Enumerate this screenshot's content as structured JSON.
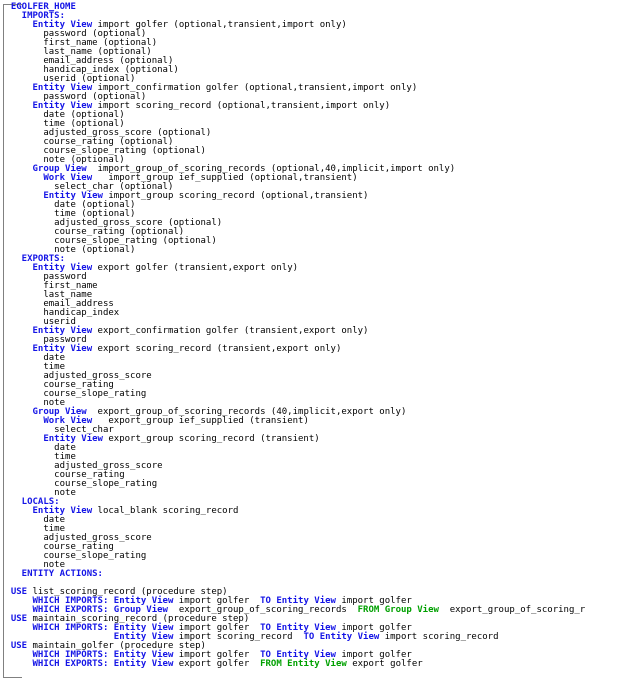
{
  "view": {
    "title": "EGOLFER_HOME",
    "frame_color": "#808080",
    "background": "#ffffff",
    "keyword_color": "#1414e6",
    "from_keyword_color": "#00a000",
    "text_color": "#000000"
  },
  "lines": [
    {
      "indent": 2,
      "parts": [
        {
          "t": "EGOLFER_HOME",
          "c": "kw"
        }
      ]
    },
    {
      "indent": 4,
      "parts": [
        {
          "t": "IMPORTS:",
          "c": "kw"
        }
      ]
    },
    {
      "indent": 6,
      "parts": [
        {
          "t": "Entity View",
          "c": "kw"
        },
        {
          "t": " import golfer (optional,transient,import only)",
          "c": "pln"
        }
      ]
    },
    {
      "indent": 8,
      "parts": [
        {
          "t": "password (optional)",
          "c": "pln"
        }
      ]
    },
    {
      "indent": 8,
      "parts": [
        {
          "t": "first_name (optional)",
          "c": "pln"
        }
      ]
    },
    {
      "indent": 8,
      "parts": [
        {
          "t": "last_name (optional)",
          "c": "pln"
        }
      ]
    },
    {
      "indent": 8,
      "parts": [
        {
          "t": "email_address (optional)",
          "c": "pln"
        }
      ]
    },
    {
      "indent": 8,
      "parts": [
        {
          "t": "handicap_index (optional)",
          "c": "pln"
        }
      ]
    },
    {
      "indent": 8,
      "parts": [
        {
          "t": "userid (optional)",
          "c": "pln"
        }
      ]
    },
    {
      "indent": 6,
      "parts": [
        {
          "t": "Entity View",
          "c": "kw"
        },
        {
          "t": " import_confirmation golfer (optional,transient,import only)",
          "c": "pln"
        }
      ]
    },
    {
      "indent": 8,
      "parts": [
        {
          "t": "password (optional)",
          "c": "pln"
        }
      ]
    },
    {
      "indent": 6,
      "parts": [
        {
          "t": "Entity View",
          "c": "kw"
        },
        {
          "t": " import scoring_record (optional,transient,import only)",
          "c": "pln"
        }
      ]
    },
    {
      "indent": 8,
      "parts": [
        {
          "t": "date (optional)",
          "c": "pln"
        }
      ]
    },
    {
      "indent": 8,
      "parts": [
        {
          "t": "time (optional)",
          "c": "pln"
        }
      ]
    },
    {
      "indent": 8,
      "parts": [
        {
          "t": "adjusted_gross_score (optional)",
          "c": "pln"
        }
      ]
    },
    {
      "indent": 8,
      "parts": [
        {
          "t": "course_rating (optional)",
          "c": "pln"
        }
      ]
    },
    {
      "indent": 8,
      "parts": [
        {
          "t": "course_slope_rating (optional)",
          "c": "pln"
        }
      ]
    },
    {
      "indent": 8,
      "parts": [
        {
          "t": "note (optional)",
          "c": "pln"
        }
      ]
    },
    {
      "indent": 6,
      "parts": [
        {
          "t": "Group View",
          "c": "kw"
        },
        {
          "t": "  import_group_of_scoring_records (optional,40,implicit,import only)",
          "c": "pln"
        }
      ]
    },
    {
      "indent": 8,
      "parts": [
        {
          "t": "Work View",
          "c": "kw"
        },
        {
          "t": "   import_group ief_supplied (optional,transient)",
          "c": "pln"
        }
      ]
    },
    {
      "indent": 10,
      "parts": [
        {
          "t": "select_char (optional)",
          "c": "pln"
        }
      ]
    },
    {
      "indent": 8,
      "parts": [
        {
          "t": "Entity View",
          "c": "kw"
        },
        {
          "t": " import_group scoring_record (optional,transient)",
          "c": "pln"
        }
      ]
    },
    {
      "indent": 10,
      "parts": [
        {
          "t": "date (optional)",
          "c": "pln"
        }
      ]
    },
    {
      "indent": 10,
      "parts": [
        {
          "t": "time (optional)",
          "c": "pln"
        }
      ]
    },
    {
      "indent": 10,
      "parts": [
        {
          "t": "adjusted_gross_score (optional)",
          "c": "pln"
        }
      ]
    },
    {
      "indent": 10,
      "parts": [
        {
          "t": "course_rating (optional)",
          "c": "pln"
        }
      ]
    },
    {
      "indent": 10,
      "parts": [
        {
          "t": "course_slope_rating (optional)",
          "c": "pln"
        }
      ]
    },
    {
      "indent": 10,
      "parts": [
        {
          "t": "note (optional)",
          "c": "pln"
        }
      ]
    },
    {
      "indent": 4,
      "parts": [
        {
          "t": "EXPORTS:",
          "c": "kw"
        }
      ]
    },
    {
      "indent": 6,
      "parts": [
        {
          "t": "Entity View",
          "c": "kw"
        },
        {
          "t": " export golfer (transient,export only)",
          "c": "pln"
        }
      ]
    },
    {
      "indent": 8,
      "parts": [
        {
          "t": "password",
          "c": "pln"
        }
      ]
    },
    {
      "indent": 8,
      "parts": [
        {
          "t": "first_name",
          "c": "pln"
        }
      ]
    },
    {
      "indent": 8,
      "parts": [
        {
          "t": "last_name",
          "c": "pln"
        }
      ]
    },
    {
      "indent": 8,
      "parts": [
        {
          "t": "email_address",
          "c": "pln"
        }
      ]
    },
    {
      "indent": 8,
      "parts": [
        {
          "t": "handicap_index",
          "c": "pln"
        }
      ]
    },
    {
      "indent": 8,
      "parts": [
        {
          "t": "userid",
          "c": "pln"
        }
      ]
    },
    {
      "indent": 6,
      "parts": [
        {
          "t": "Entity View",
          "c": "kw"
        },
        {
          "t": " export_confirmation golfer (transient,export only)",
          "c": "pln"
        }
      ]
    },
    {
      "indent": 8,
      "parts": [
        {
          "t": "password",
          "c": "pln"
        }
      ]
    },
    {
      "indent": 6,
      "parts": [
        {
          "t": "Entity View",
          "c": "kw"
        },
        {
          "t": " export scoring_record (transient,export only)",
          "c": "pln"
        }
      ]
    },
    {
      "indent": 8,
      "parts": [
        {
          "t": "date",
          "c": "pln"
        }
      ]
    },
    {
      "indent": 8,
      "parts": [
        {
          "t": "time",
          "c": "pln"
        }
      ]
    },
    {
      "indent": 8,
      "parts": [
        {
          "t": "adjusted_gross_score",
          "c": "pln"
        }
      ]
    },
    {
      "indent": 8,
      "parts": [
        {
          "t": "course_rating",
          "c": "pln"
        }
      ]
    },
    {
      "indent": 8,
      "parts": [
        {
          "t": "course_slope_rating",
          "c": "pln"
        }
      ]
    },
    {
      "indent": 8,
      "parts": [
        {
          "t": "note",
          "c": "pln"
        }
      ]
    },
    {
      "indent": 6,
      "parts": [
        {
          "t": "Group View",
          "c": "kw"
        },
        {
          "t": "  export_group_of_scoring_records (40,implicit,export only)",
          "c": "pln"
        }
      ]
    },
    {
      "indent": 8,
      "parts": [
        {
          "t": "Work View",
          "c": "kw"
        },
        {
          "t": "   export_group ief_supplied (transient)",
          "c": "pln"
        }
      ]
    },
    {
      "indent": 10,
      "parts": [
        {
          "t": "select_char",
          "c": "pln"
        }
      ]
    },
    {
      "indent": 8,
      "parts": [
        {
          "t": "Entity View",
          "c": "kw"
        },
        {
          "t": " export_group scoring_record (transient)",
          "c": "pln"
        }
      ]
    },
    {
      "indent": 10,
      "parts": [
        {
          "t": "date",
          "c": "pln"
        }
      ]
    },
    {
      "indent": 10,
      "parts": [
        {
          "t": "time",
          "c": "pln"
        }
      ]
    },
    {
      "indent": 10,
      "parts": [
        {
          "t": "adjusted_gross_score",
          "c": "pln"
        }
      ]
    },
    {
      "indent": 10,
      "parts": [
        {
          "t": "course_rating",
          "c": "pln"
        }
      ]
    },
    {
      "indent": 10,
      "parts": [
        {
          "t": "course_slope_rating",
          "c": "pln"
        }
      ]
    },
    {
      "indent": 10,
      "parts": [
        {
          "t": "note",
          "c": "pln"
        }
      ]
    },
    {
      "indent": 4,
      "parts": [
        {
          "t": "LOCALS:",
          "c": "kw"
        }
      ]
    },
    {
      "indent": 6,
      "parts": [
        {
          "t": "Entity View",
          "c": "kw"
        },
        {
          "t": " local_blank scoring_record",
          "c": "pln"
        }
      ]
    },
    {
      "indent": 8,
      "parts": [
        {
          "t": "date",
          "c": "pln"
        }
      ]
    },
    {
      "indent": 8,
      "parts": [
        {
          "t": "time",
          "c": "pln"
        }
      ]
    },
    {
      "indent": 8,
      "parts": [
        {
          "t": "adjusted_gross_score",
          "c": "pln"
        }
      ]
    },
    {
      "indent": 8,
      "parts": [
        {
          "t": "course_rating",
          "c": "pln"
        }
      ]
    },
    {
      "indent": 8,
      "parts": [
        {
          "t": "course_slope_rating",
          "c": "pln"
        }
      ]
    },
    {
      "indent": 8,
      "parts": [
        {
          "t": "note",
          "c": "pln"
        }
      ]
    },
    {
      "indent": 4,
      "parts": [
        {
          "t": "ENTITY ACTIONS:",
          "c": "kw"
        }
      ]
    },
    {
      "indent": 0,
      "parts": []
    },
    {
      "indent": 2,
      "parts": [
        {
          "t": "USE",
          "c": "kw"
        },
        {
          "t": " list_scoring_record (procedure step)",
          "c": "pln"
        }
      ]
    },
    {
      "indent": 6,
      "parts": [
        {
          "t": "WHICH IMPORTS: Entity View",
          "c": "kw"
        },
        {
          "t": " import golfer  ",
          "c": "pln"
        },
        {
          "t": "TO Entity View",
          "c": "kw"
        },
        {
          "t": " import golfer",
          "c": "pln"
        }
      ]
    },
    {
      "indent": 6,
      "parts": [
        {
          "t": "WHICH EXPORTS: Group View",
          "c": "kw"
        },
        {
          "t": "  export_group_of_scoring_records  ",
          "c": "pln"
        },
        {
          "t": "FROM Group View",
          "c": "grn"
        },
        {
          "t": "  export_group_of_scoring_r",
          "c": "pln"
        }
      ]
    },
    {
      "indent": 2,
      "parts": [
        {
          "t": "USE",
          "c": "kw"
        },
        {
          "t": " maintain_scoring_record (procedure step)",
          "c": "pln"
        }
      ]
    },
    {
      "indent": 6,
      "parts": [
        {
          "t": "WHICH IMPORTS: Entity View",
          "c": "kw"
        },
        {
          "t": " import golfer  ",
          "c": "pln"
        },
        {
          "t": "TO Entity View",
          "c": "kw"
        },
        {
          "t": " import golfer",
          "c": "pln"
        }
      ]
    },
    {
      "indent": 21,
      "parts": [
        {
          "t": "Entity View",
          "c": "kw"
        },
        {
          "t": " import scoring_record  ",
          "c": "pln"
        },
        {
          "t": "TO Entity View",
          "c": "kw"
        },
        {
          "t": " import scoring_record",
          "c": "pln"
        }
      ]
    },
    {
      "indent": 2,
      "parts": [
        {
          "t": "USE",
          "c": "kw"
        },
        {
          "t": " maintain_golfer (procedure step)",
          "c": "pln"
        }
      ]
    },
    {
      "indent": 6,
      "parts": [
        {
          "t": "WHICH IMPORTS: Entity View",
          "c": "kw"
        },
        {
          "t": " import golfer  ",
          "c": "pln"
        },
        {
          "t": "TO Entity View",
          "c": "kw"
        },
        {
          "t": " import golfer",
          "c": "pln"
        }
      ]
    },
    {
      "indent": 6,
      "parts": [
        {
          "t": "WHICH EXPORTS: Entity View",
          "c": "kw"
        },
        {
          "t": " export golfer  ",
          "c": "pln"
        },
        {
          "t": "FROM Entity View",
          "c": "grn"
        },
        {
          "t": " export golfer",
          "c": "pln"
        }
      ]
    }
  ]
}
